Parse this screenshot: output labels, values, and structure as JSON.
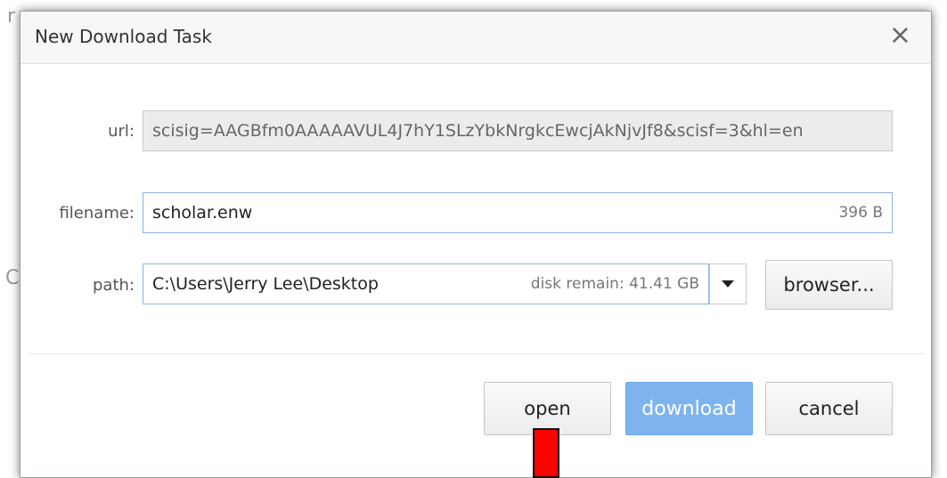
{
  "background": {
    "char_top": "r",
    "char_mid": "C"
  },
  "dialog": {
    "title": "New Download Task",
    "close_glyph": "×"
  },
  "form": {
    "url_label": "url:",
    "url_value": "scisig=AAGBfm0AAAAAVUL4J7hY1SLzYbkNrgkcEwcjAkNjvJf8&scisf=3&hl=en",
    "filename_label": "filename:",
    "filename_value": "scholar.enw",
    "file_size": "396 B",
    "path_label": "path:",
    "path_value": "C:\\Users\\Jerry Lee\\Desktop",
    "disk_remain": "disk remain: 41.41 GB",
    "browse_label": "browser..."
  },
  "actions": {
    "open_label": "open",
    "download_label": "download",
    "cancel_label": "cancel"
  },
  "colors": {
    "primary": "#7db4f0",
    "marker": "#ff0000"
  }
}
